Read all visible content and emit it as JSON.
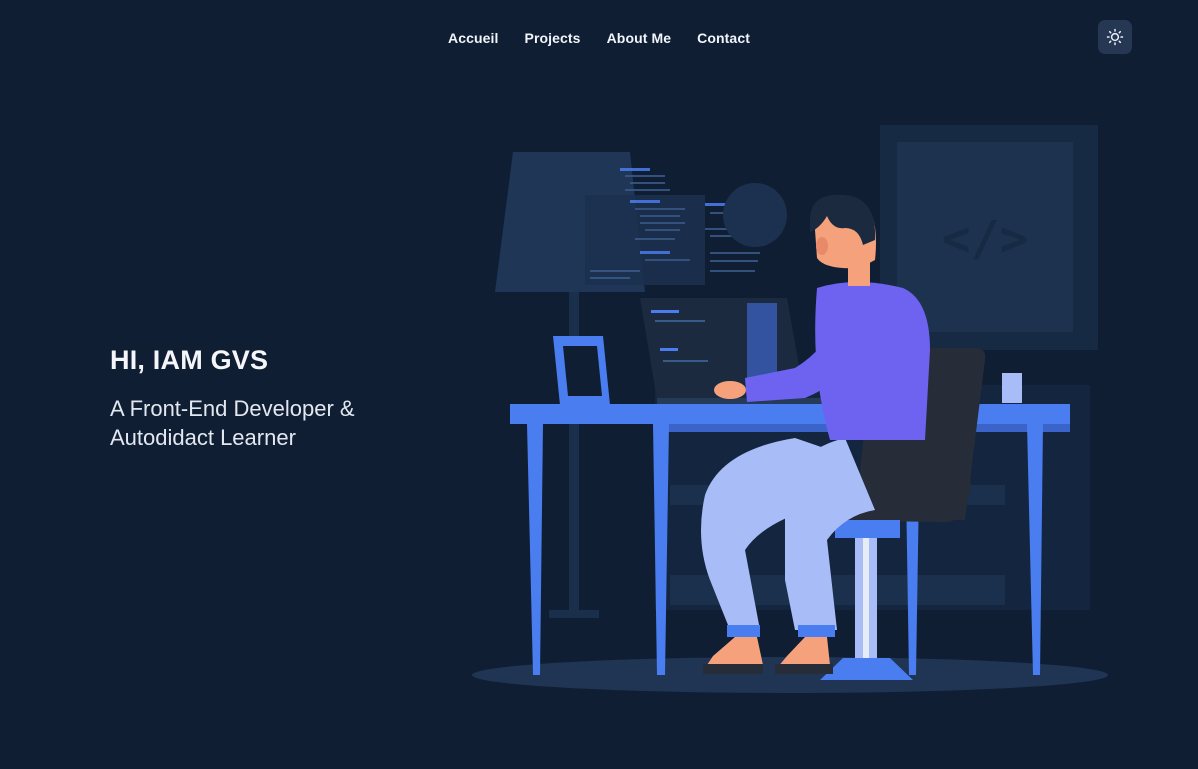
{
  "nav": {
    "items": [
      {
        "label": "Accueil"
      },
      {
        "label": "Projects"
      },
      {
        "label": "About Me"
      },
      {
        "label": "Contact"
      }
    ]
  },
  "theme_toggle": {
    "icon": "sun-icon"
  },
  "hero": {
    "title": "HI, IAM GVS",
    "subtitle_line1": "A Front-End Developer &",
    "subtitle_line2": "Autodidact Learner"
  },
  "illustration": {
    "code_symbol": "</>",
    "colors": {
      "background": "#0f1e33",
      "desk": "#4a7ef0",
      "shirt": "#6e63f0",
      "pants": "#a8bdf7",
      "chair": "#262d38",
      "skin": "#f5a27c",
      "hair": "#1c2a40"
    }
  }
}
